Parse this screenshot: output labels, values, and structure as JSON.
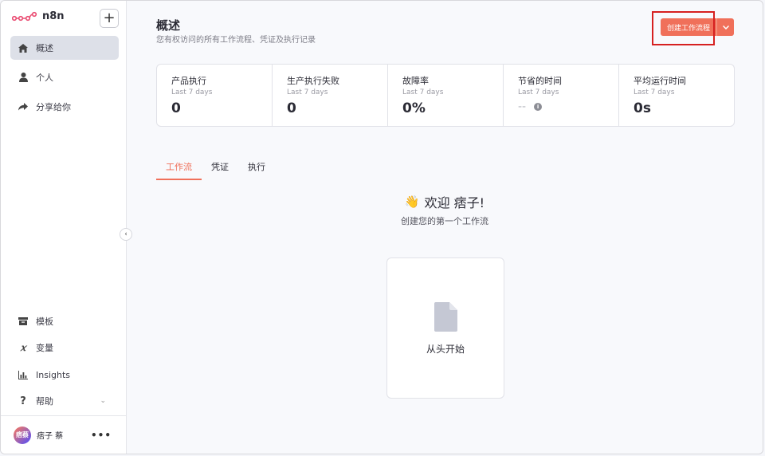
{
  "app": {
    "name": "n8n"
  },
  "sidebar": {
    "items": [
      {
        "label": "概述",
        "icon": "home-icon",
        "active": true
      },
      {
        "label": "个人",
        "icon": "user-icon",
        "active": false
      },
      {
        "label": "分享给你",
        "icon": "share-icon",
        "active": false
      }
    ],
    "bottom_items": [
      {
        "label": "模板",
        "icon": "box-icon"
      },
      {
        "label": "变量",
        "icon": "variable-icon"
      },
      {
        "label": "Insights",
        "icon": "chart-icon"
      },
      {
        "label": "帮助",
        "icon": "question-icon"
      }
    ],
    "user": {
      "avatar_text": "痞蔡",
      "name": "痞子 蔡"
    }
  },
  "header": {
    "title": "概述",
    "subtitle": "您有权访问的所有工作流程、凭证及执行记录",
    "create_label": "创建工作流程"
  },
  "stats": [
    {
      "label": "产品执行",
      "period": "Last 7 days",
      "value": "0"
    },
    {
      "label": "生产执行失败",
      "period": "Last 7 days",
      "value": "0"
    },
    {
      "label": "故障率",
      "period": "Last 7 days",
      "value": "0%"
    },
    {
      "label": "节省的时间",
      "period": "Last 7 days",
      "value": "--"
    },
    {
      "label": "平均运行时间",
      "period": "Last 7 days",
      "value": "0s"
    }
  ],
  "tabs": [
    {
      "label": "工作流",
      "active": true
    },
    {
      "label": "凭证",
      "active": false
    },
    {
      "label": "执行",
      "active": false
    }
  ],
  "empty_state": {
    "welcome": "欢迎 痞子!",
    "subtitle": "创建您的第一个工作流",
    "card_label": "从头开始"
  },
  "colors": {
    "accent": "#f0705a",
    "highlight": "#d62020"
  }
}
